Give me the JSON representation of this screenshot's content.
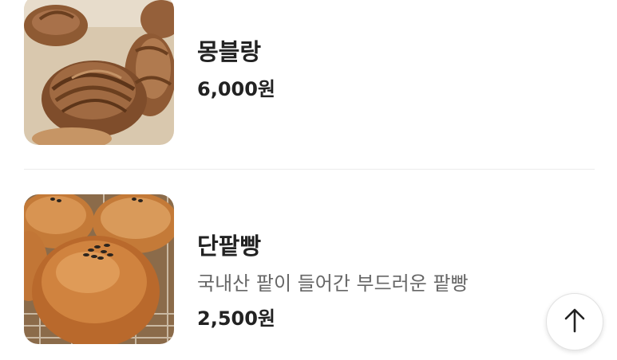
{
  "menu": {
    "items": [
      {
        "name": "몽블랑",
        "price": "6,000원",
        "image": "mont-blanc-pastry-photo"
      },
      {
        "name": "단팥빵",
        "description": "국내산 팥이 들어간 부드러운 팥빵",
        "price": "2,500원",
        "image": "red-bean-bun-photo"
      }
    ]
  },
  "scroll_top_button": {
    "icon": "arrow-up-icon"
  }
}
